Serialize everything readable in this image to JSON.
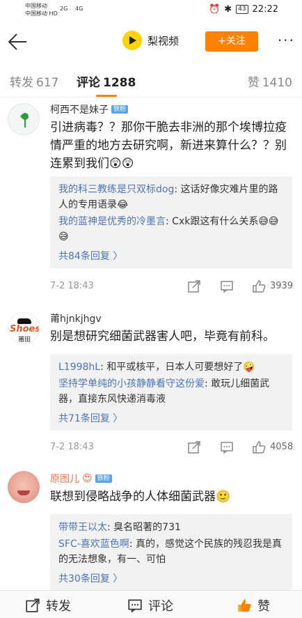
{
  "status_bar": {
    "carrier1": "中国移动",
    "carrier2": "中国移动",
    "carrier2_tag": "HD",
    "signal_labels": [
      "2G",
      "4G"
    ],
    "battery": "43",
    "time": "22:22"
  },
  "header": {
    "brand_name": "梨视频",
    "follow_label": "+关注",
    "more_label": "···"
  },
  "tabs": {
    "repost_label": "转发",
    "repost_count": "617",
    "comments_label": "评论",
    "comments_count": "1288",
    "likes_label": "赞",
    "likes_count": "1410"
  },
  "comments": [
    {
      "username": "柯西不是妹子",
      "badge": "铁粉",
      "text": "引进病毒？？那你干脆去非洲的那个埃博拉疫情严重的地方去研究啊，新进来算什么？？别连累到我们😲😲",
      "replies": [
        {
          "name": "我的科三教练是只双标dog",
          "text": ": 这话好像灾难片里的路人的专用语录😂"
        },
        {
          "name": "我的蓝神是优秀的冷墨言",
          "text": ": Cxk跟这有什么关系😅😅😅"
        }
      ],
      "more_replies": "共84条回复 〉",
      "date": "7-2 18:43",
      "likes": "3939"
    },
    {
      "username": "莆hjnkjhgv",
      "avatar_text": [
        "Shoes",
        "莆田"
      ],
      "text": "别是想研究细菌武器害人吧，毕竟有前科。",
      "replies": [
        {
          "name": "L1998hL",
          "text": ": 和平或核平，日本人可要想好了🤪"
        },
        {
          "name": "坚持学单纯的小孩静静看守这份爱",
          "text": ": 敢玩儿细菌武器，直接东风快递消毒液"
        }
      ],
      "more_replies": "共71条回复 〉",
      "date": "7-2 18:43",
      "likes": "4058"
    },
    {
      "username": "原图儿",
      "name_emoji": "😍",
      "badge": "铁粉",
      "text": "联想到侵略战争的人体细菌武器🙂",
      "replies": [
        {
          "name": "带带王以太",
          "text": ": 臭名昭著的731"
        },
        {
          "name": "SFC-喜欢蓝色啊",
          "text": ": 真的，感觉这个民族的残忍我是真的无法想象，有一、可怕"
        }
      ],
      "more_replies": "共30条回复 〉"
    }
  ],
  "bottom_bar": {
    "repost_label": "转发",
    "comment_label": "评论",
    "like_label": "赞"
  },
  "colors": {
    "accent": "#ff8200",
    "link": "#4b73b4",
    "reply_bg": "#f2f2f2"
  }
}
